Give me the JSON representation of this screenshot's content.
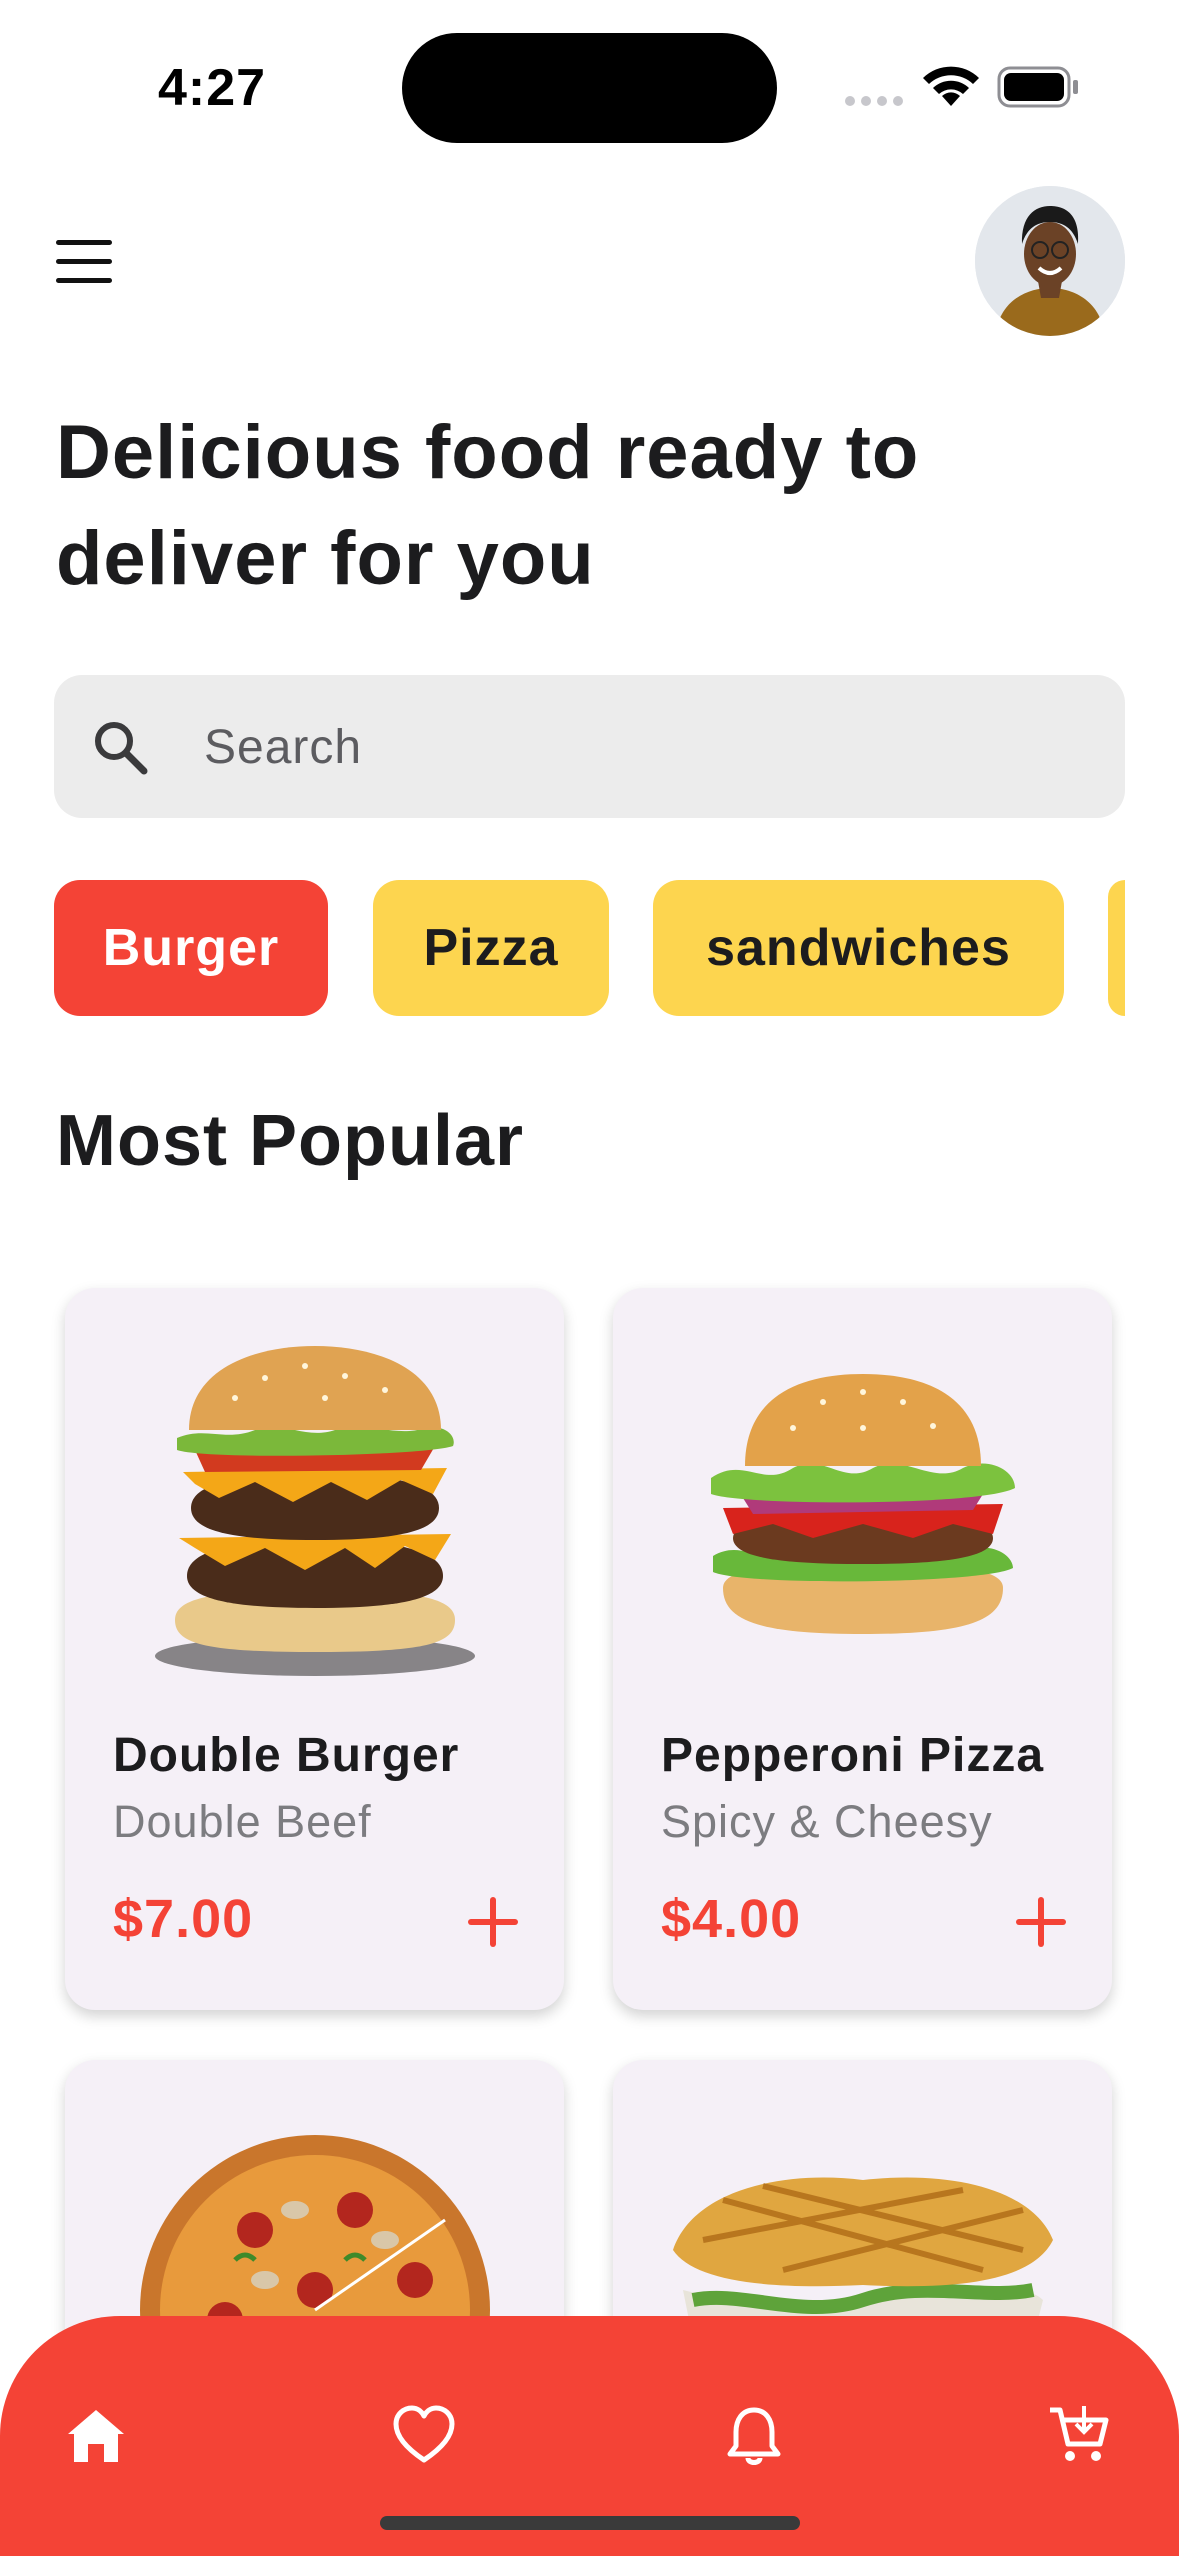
{
  "status_bar": {
    "time": "4:27",
    "icons": [
      "cellular-signal-icon",
      "wifi-icon",
      "battery-icon"
    ]
  },
  "header": {
    "menu_icon": "hamburger-menu-icon",
    "avatar_alt": "user-avatar"
  },
  "headline": "Delicious food ready to deliver for you",
  "search": {
    "placeholder": "Search",
    "value": "",
    "icon": "search-icon"
  },
  "categories": [
    {
      "label": "Burger",
      "selected": true
    },
    {
      "label": "Pizza",
      "selected": false
    },
    {
      "label": "sandwiches",
      "selected": false
    }
  ],
  "section_title": "Most Popular",
  "products": [
    {
      "name": "Double Burger",
      "subtitle": "Double Beef",
      "price": "$7.00",
      "image": "double-burger-image"
    },
    {
      "name": "Pepperoni Pizza",
      "subtitle": "Spicy & Cheesy",
      "price": "$4.00",
      "image": "burger-image"
    },
    {
      "image": "pizza-image"
    },
    {
      "image": "waffle-sandwich-image"
    }
  ],
  "bottom_nav": {
    "items": [
      "home-icon",
      "heart-icon",
      "bell-icon",
      "cart-icon"
    ],
    "active": "home-icon"
  },
  "colors": {
    "accent": "#f44336",
    "chip_inactive": "#fdd54f",
    "card_bg": "#f5f0f7",
    "search_bg": "#ececec"
  }
}
